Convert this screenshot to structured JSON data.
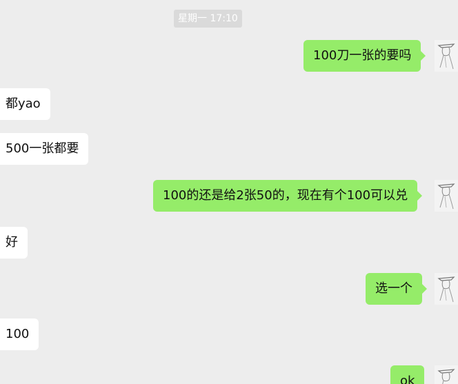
{
  "timestamp": "星期一 17:10",
  "messages": [
    {
      "side": "out",
      "text": "100刀一张的要吗"
    },
    {
      "side": "in",
      "text": "都yao"
    },
    {
      "side": "in",
      "text": "500一张都要"
    },
    {
      "side": "out",
      "text": "100的还是给2张50的，现在有个100可以兑"
    },
    {
      "side": "in",
      "text": "好"
    },
    {
      "side": "out",
      "text": "选一个"
    },
    {
      "side": "in",
      "text": "100"
    },
    {
      "side": "out",
      "text": "ok"
    }
  ],
  "avatar_icon": "sketch-portrait-avatar-icon",
  "colors": {
    "background": "#ededed",
    "outgoing_bubble": "#95ec69",
    "incoming_bubble": "#ffffff",
    "timestamp_bg": "#dadada"
  }
}
